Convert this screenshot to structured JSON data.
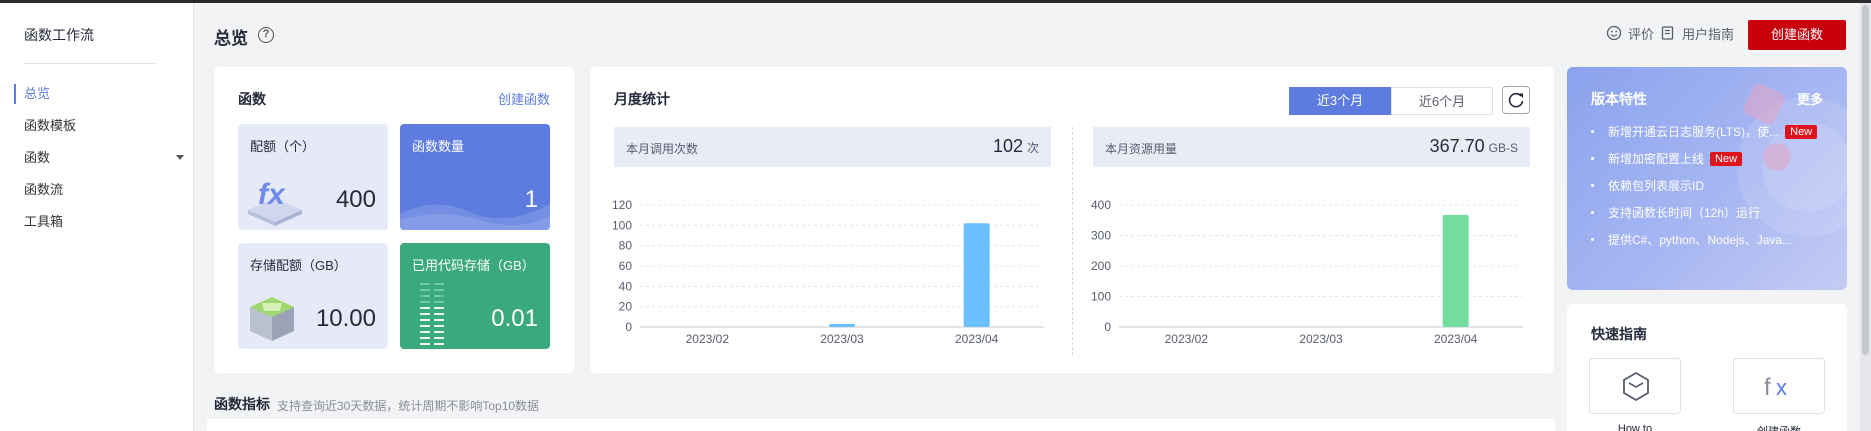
{
  "sidebar": {
    "title": "函数工作流",
    "items": [
      {
        "label": "总览"
      },
      {
        "label": "函数模板"
      },
      {
        "label": "函数"
      },
      {
        "label": "函数流"
      },
      {
        "label": "工具箱"
      }
    ]
  },
  "header": {
    "title": "总览",
    "help": "?",
    "rate": "评价",
    "guide": "用户指南",
    "create": "创建函数"
  },
  "functions_card": {
    "title": "函数",
    "create_link": "创建函数",
    "tiles": [
      {
        "label": "配额（个）",
        "value": "400"
      },
      {
        "label": "函数数量",
        "value": "1"
      },
      {
        "label": "存储配额（GB）",
        "value": "10.00"
      },
      {
        "label": "已用代码存储（GB）",
        "value": "0.01"
      }
    ]
  },
  "monthly": {
    "title": "月度统计",
    "tabs": [
      "近3个月",
      "近6个月"
    ],
    "calls": {
      "label": "本月调用次数",
      "value": "102",
      "unit": "次"
    },
    "resource": {
      "label": "本月资源用量",
      "value": "367.70",
      "unit": "GB-S"
    }
  },
  "chart_data": [
    {
      "type": "bar",
      "categories": [
        "2023/02",
        "2023/03",
        "2023/04"
      ],
      "values": [
        0,
        3,
        102
      ],
      "ylim": [
        0,
        120
      ],
      "yticks": [
        0,
        20,
        40,
        60,
        80,
        100,
        120
      ],
      "color": "#6cbfff"
    },
    {
      "type": "bar",
      "categories": [
        "2023/02",
        "2023/03",
        "2023/04"
      ],
      "values": [
        0,
        0,
        367.7
      ],
      "ylim": [
        0,
        400
      ],
      "yticks": [
        0,
        100,
        200,
        300,
        400
      ],
      "color": "#73dda0"
    }
  ],
  "features": {
    "title": "版本特性",
    "more": "更多",
    "new_badge": "New",
    "items": [
      "新增开通云日志服务(LTS)，使...",
      "新增加密配置上线",
      "依赖包列表展示ID",
      "支持函数长时间（12h）运行",
      "提供C#、python、Nodejs、Java..."
    ]
  },
  "quick_guide": {
    "title": "快速指南",
    "items": [
      "How to",
      "创建函数"
    ]
  },
  "metrics": {
    "title": "函数指标",
    "note": "支持查询近30天数据，统计周期不影响Top10数据"
  },
  "colors": {
    "accent": "#5e7ce0",
    "brand_red": "#c7000b",
    "green_tile": "#3aaa7e"
  }
}
